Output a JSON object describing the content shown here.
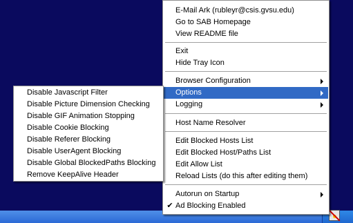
{
  "main_menu": {
    "email": "E-Mail Ark (rubleyr@csis.gvsu.edu)",
    "go_home": "Go to SAB Homepage",
    "readme": "View README file",
    "exit": "Exit",
    "hide_tray": "Hide Tray Icon",
    "browser_config": "Browser Configuration",
    "options": "Options",
    "logging": "Logging",
    "host_resolver": "Host Name Resolver",
    "edit_hosts": "Edit Blocked Hosts List",
    "edit_paths": "Edit Blocked Host/Paths List",
    "edit_allow": "Edit Allow List",
    "reload": "Reload Lists (do this after editing them)",
    "autorun": "Autorun on Startup",
    "ad_blocking": "Ad Blocking Enabled",
    "ad_blocking_checked": true
  },
  "options_menu": {
    "items": [
      "Disable Javascript Filter",
      "Disable Picture Dimension Checking",
      "Disable GIF Animation Stopping",
      "Disable Cookie Blocking",
      "Disable Referer Blocking",
      "Disable UserAgent Blocking",
      "Disable Global BlockedPaths Blocking",
      "Remove KeepAlive Header"
    ]
  },
  "colors": {
    "desktop": "#0a0a5e",
    "highlight": "#316ac5",
    "taskbar": "#2b69d6"
  },
  "icons": {
    "check": "✔",
    "tray": "ad-blocker-tray-icon"
  }
}
